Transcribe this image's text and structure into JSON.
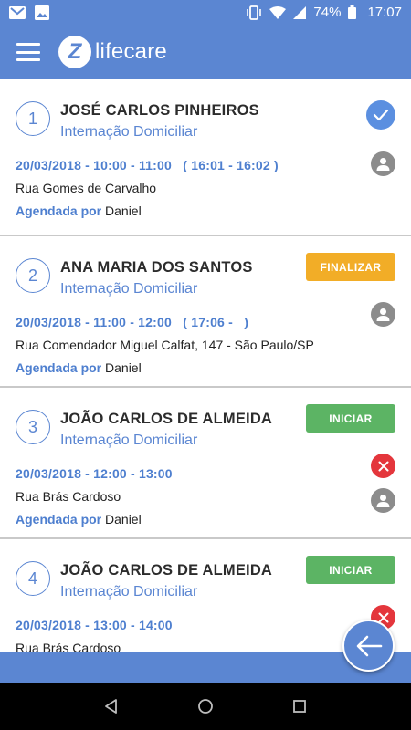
{
  "status_bar": {
    "battery": "74%",
    "time": "17:07"
  },
  "app": {
    "logo_letter": "Z",
    "name": "lifecare"
  },
  "appointments": [
    {
      "number": "1",
      "patient": "JOSÉ CARLOS PINHEIROS",
      "service": "Internação Domiciliar",
      "datetime": "20/03/2018 - 10:00 - 11:00",
      "actual_time": "( 16:01 - 16:02 )",
      "address": "Rua Gomes de Carvalho",
      "scheduled_by_label": "Agendada por",
      "scheduled_by": "Daniel",
      "status": "done"
    },
    {
      "number": "2",
      "patient": "ANA MARIA DOS SANTOS",
      "service": "Internação Domiciliar",
      "datetime": "20/03/2018 - 11:00 - 12:00",
      "actual_time": "( 17:06 -   )",
      "address": "Rua Comendador Miguel Calfat, 147 - São Paulo/SP",
      "scheduled_by_label": "Agendada por",
      "scheduled_by": "Daniel",
      "action_label": "FINALIZAR"
    },
    {
      "number": "3",
      "patient": "JOÃO CARLOS DE ALMEIDA",
      "service": "Internação Domiciliar",
      "datetime": "20/03/2018 - 12:00 - 13:00",
      "address": "Rua Brás Cardoso",
      "scheduled_by_label": "Agendada por",
      "scheduled_by": "Daniel",
      "action_label": "INICIAR"
    },
    {
      "number": "4",
      "patient": "JOÃO CARLOS DE ALMEIDA",
      "service": "Internação Domiciliar",
      "datetime": "20/03/2018 - 13:00 - 14:00",
      "address": "Rua Brás Cardoso",
      "action_label": "INICIAR"
    }
  ],
  "colors": {
    "primary": "#5b86d2",
    "finalizar": "#f2ad27",
    "iniciar": "#5cb464",
    "cancel": "#e4363c",
    "check": "#5b8fe0"
  },
  "icons": {
    "menu": "hamburger-menu-icon",
    "status_done": "check-icon",
    "patient": "person-icon",
    "cancel": "close-icon",
    "fab": "arrow-left-icon"
  }
}
